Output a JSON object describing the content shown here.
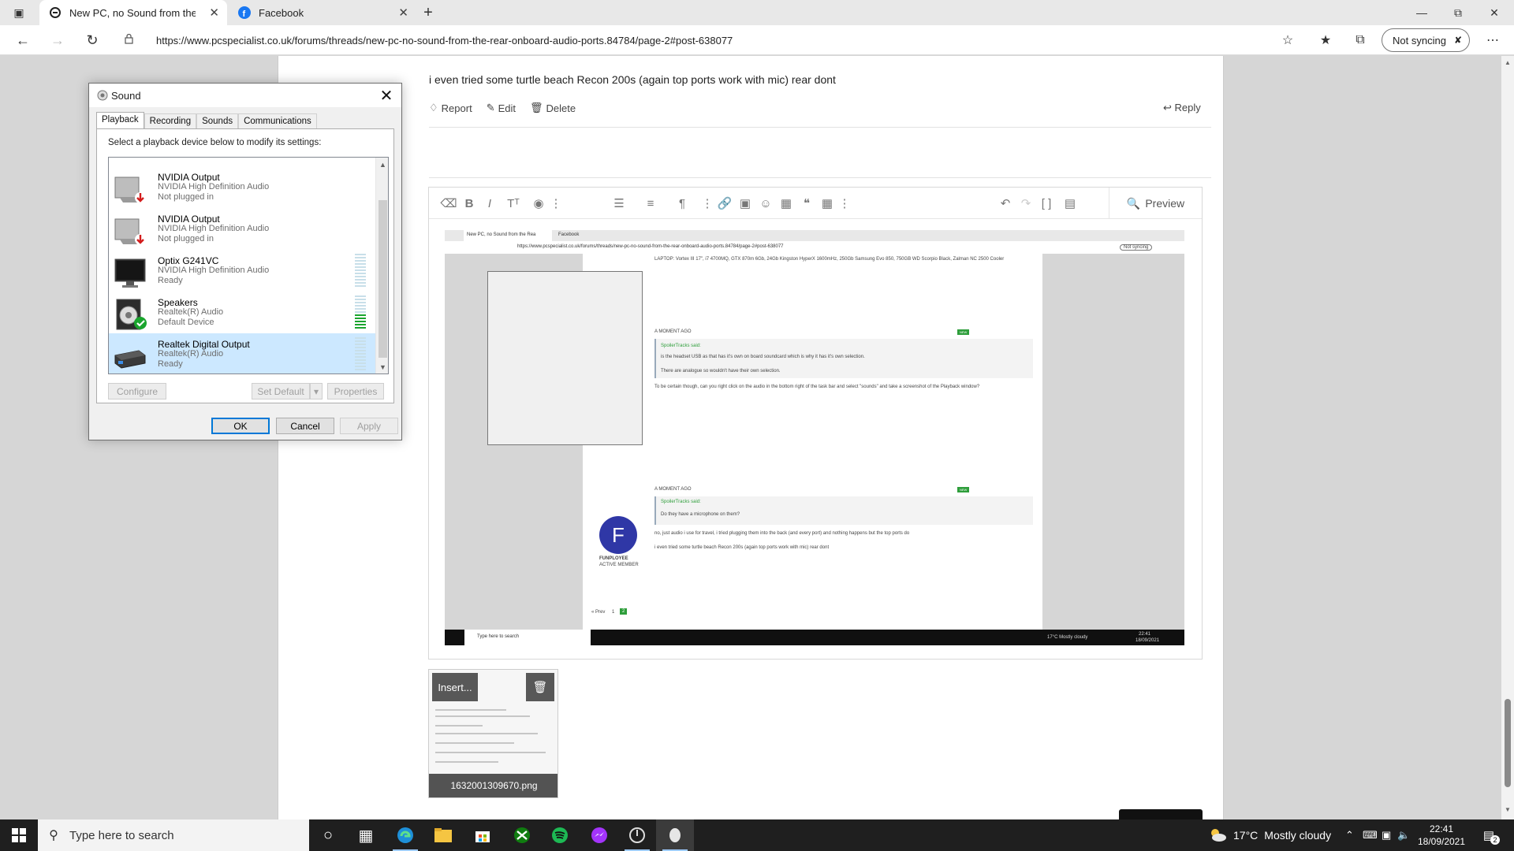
{
  "browser": {
    "tabs": [
      {
        "title": "New PC, no Sound from the Rea",
        "favicon": "pcspecialist-icon"
      },
      {
        "title": "Facebook",
        "favicon": "facebook-icon"
      }
    ],
    "url": "https://www.pcspecialist.co.uk/forums/threads/new-pc-no-sound-from-the-rear-onboard-audio-ports.84784/page-2#post-638077",
    "sync_label": "Not syncing"
  },
  "post": {
    "text": "i even tried some turtle beach Recon 200s (again top ports work with mic) rear dont",
    "actions": {
      "report": "Report",
      "edit": "Edit",
      "delete": "Delete",
      "reply": "Reply"
    }
  },
  "editor": {
    "preview_label": "Preview",
    "attachment": {
      "insert_label": "Insert...",
      "filename": "1632001309670.png"
    }
  },
  "screenshot": {
    "tab1": "New PC, no Sound from the Rea",
    "tab2": "Facebook",
    "url": "https://www.pcspecialist.co.uk/forums/threads/new-pc-no-sound-from-the-rear-onboard-audio-ports.84784/page-2#post-638077",
    "sync": "Not syncing",
    "lines": {
      "laptop": "LAPTOP: Vortex III 17\", i7 4700MQ, GTX 870m 6Gb, 24Gb Kingston HyperX 1600mHz, 250Gb Samsung Evo 850, 750GB WD Scorpio Black, Zalman NC 2500 Cooler",
      "moment1": "A MOMENT AGO",
      "new1": "NEW",
      "quoter1": "SpoilerTracks said:",
      "q1a": "is the headset USB as that has it's own on board soundcard which is why it has it's own selection.",
      "q1b": "There are analogue so wouldn't have their own selection.",
      "body1": "To be certain though, can you right click on the audio in the bottom right of the task bar and select \"sounds\" and take a screenshot of the Playback window?",
      "moment2": "A MOMENT AGO",
      "new2": "NEW",
      "quoter2": "SpoilerTracks said:",
      "q2": "Do they have a microphone on them?",
      "reply1": "no, just audio i use for travel, i tried plugging them into the back (and every port) and nothing happens but the top ports do",
      "reply2": "i even tried some turtle beach Recon 200s (again top ports work with mic) rear dont",
      "user_initial": "F",
      "user_name": "FUNPLOYEE",
      "user_role": "ACTIVE MEMBER",
      "prev": "« Prev",
      "page1": "1",
      "page2": "2",
      "search": "Type here to search",
      "weather": "17°C  Mostly cloudy",
      "time": "22:41",
      "date": "18/09/2021"
    }
  },
  "sound_dialog": {
    "title": "Sound",
    "tabs": [
      "Playback",
      "Recording",
      "Sounds",
      "Communications"
    ],
    "instruction": "Select a playback device below to modify its settings:",
    "devices": [
      {
        "name": "NVIDIA Output",
        "driver": "NVIDIA High Definition Audio",
        "status": "Not plugged in",
        "icon": "speaker-unplugged-icon"
      },
      {
        "name": "NVIDIA Output",
        "driver": "NVIDIA High Definition Audio",
        "status": "Not plugged in",
        "icon": "speaker-unplugged-icon"
      },
      {
        "name": "Optix G241VC",
        "driver": "NVIDIA High Definition Audio",
        "status": "Ready",
        "icon": "monitor-icon"
      },
      {
        "name": "Speakers",
        "driver": "Realtek(R) Audio",
        "status": "Default Device",
        "icon": "speaker-default-icon"
      },
      {
        "name": "Realtek Digital Output",
        "driver": "Realtek(R) Audio",
        "status": "Ready",
        "icon": "digital-output-icon"
      }
    ],
    "buttons": {
      "configure": "Configure",
      "set_default": "Set Default",
      "properties": "Properties",
      "ok": "OK",
      "cancel": "Cancel",
      "apply": "Apply"
    }
  },
  "taskbar": {
    "search_placeholder": "Type here to search",
    "temperature": "17°C",
    "weather": "Mostly cloudy",
    "time": "22:41",
    "date": "18/09/2021",
    "notifications": "2"
  }
}
